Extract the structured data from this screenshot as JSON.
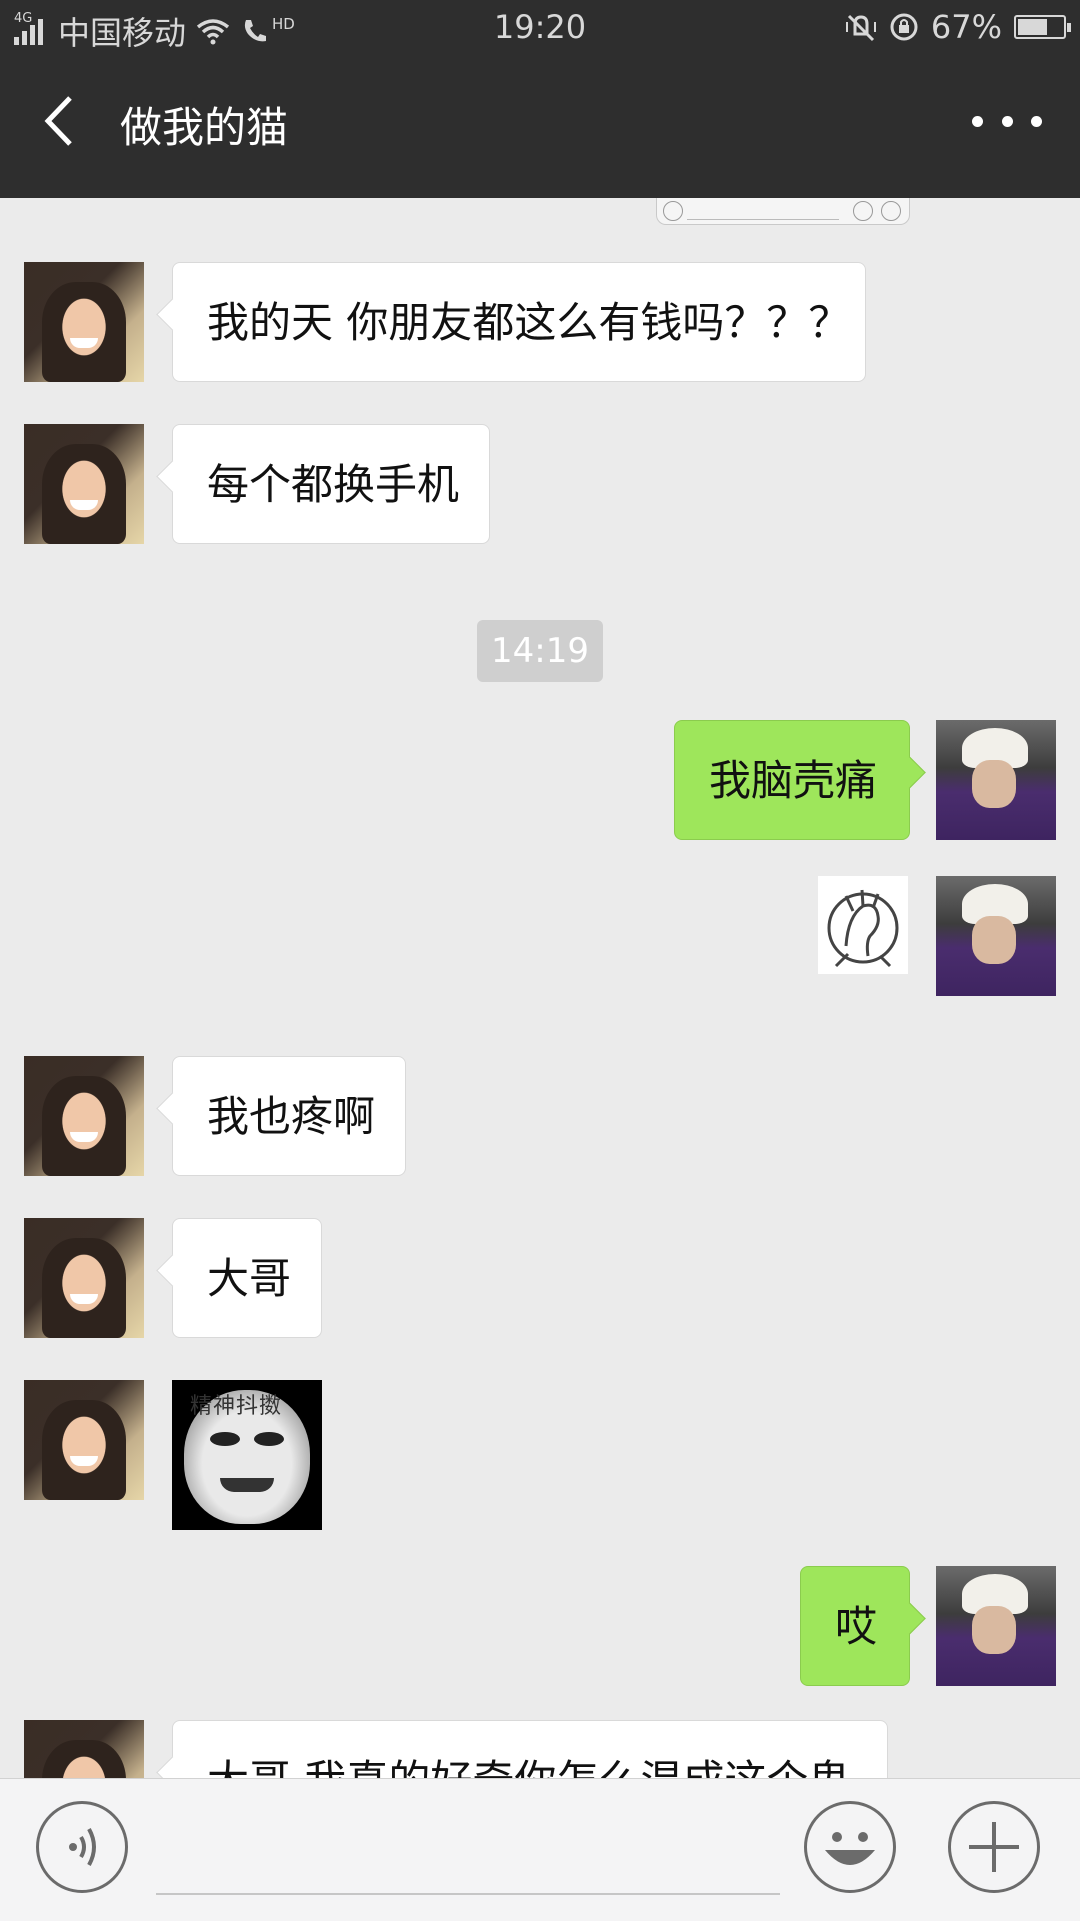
{
  "status_bar": {
    "network": "4G",
    "carrier": "中国移动",
    "hd": "HD",
    "time": "19:20",
    "battery_percent": "67%",
    "battery_level": 0.67
  },
  "header": {
    "title": "做我的猫",
    "back_icon": "chevron-left-icon",
    "more_icon": "more-dots-icon"
  },
  "messages": [
    {
      "side": "in",
      "type": "text",
      "text": "我的天  你朋友都这么有钱吗？？？"
    },
    {
      "side": "in",
      "type": "text",
      "text": "每个都换手机"
    },
    {
      "type": "time",
      "text": "14:19"
    },
    {
      "side": "out",
      "type": "text",
      "text": "我脑壳痛"
    },
    {
      "side": "out",
      "type": "sticker",
      "sticker": "facepalm-sticker"
    },
    {
      "side": "in",
      "type": "text",
      "text": "我也疼啊"
    },
    {
      "side": "in",
      "type": "text",
      "text": "大哥"
    },
    {
      "side": "in",
      "type": "sticker",
      "sticker": "meme-face-sticker",
      "caption": "精神抖擞"
    },
    {
      "side": "out",
      "type": "text",
      "text": "哎"
    },
    {
      "side": "in",
      "type": "text",
      "text": "大哥  我真的好奇你怎么混成这个鬼"
    }
  ],
  "input_bar": {
    "voice_icon": "voice-icon",
    "emoji_icon": "emoji-icon",
    "plus_icon": "plus-icon"
  },
  "colors": {
    "header_bg": "#2e2e2e",
    "chat_bg": "#ebebeb",
    "out_bubble": "#9ee65b",
    "in_bubble": "#ffffff"
  }
}
